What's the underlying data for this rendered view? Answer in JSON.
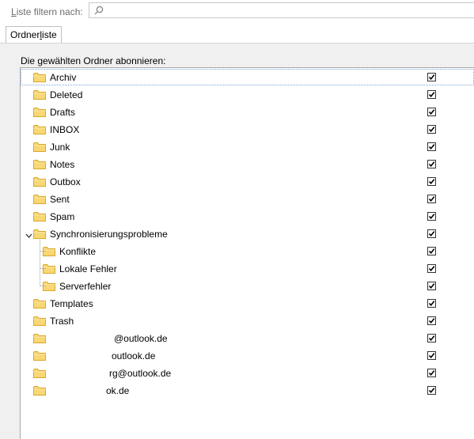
{
  "filter": {
    "label_prefix": "L",
    "label_rest": "iste filtern nach:",
    "search_icon": "search-icon",
    "value": ""
  },
  "tabs": [
    {
      "label_prefix": "Ordner",
      "label_underlined": "l",
      "label_rest": "iste"
    }
  ],
  "section_label": "Die gewählten Ordner abonnieren:",
  "folders": [
    {
      "label": "Archiv",
      "checked": true,
      "level": 0
    },
    {
      "label": "Deleted",
      "checked": true,
      "level": 0
    },
    {
      "label": "Drafts",
      "checked": true,
      "level": 0
    },
    {
      "label": "INBOX",
      "checked": true,
      "level": 0
    },
    {
      "label": "Junk",
      "checked": true,
      "level": 0
    },
    {
      "label": "Notes",
      "checked": true,
      "level": 0
    },
    {
      "label": "Outbox",
      "checked": true,
      "level": 0
    },
    {
      "label": "Sent",
      "checked": true,
      "level": 0
    },
    {
      "label": "Spam",
      "checked": true,
      "level": 0
    },
    {
      "label": "Synchronisierungsprobleme",
      "checked": true,
      "level": 0,
      "expanded": true
    },
    {
      "label": "Konflikte",
      "checked": true,
      "level": 1
    },
    {
      "label": "Lokale Fehler",
      "checked": true,
      "level": 1
    },
    {
      "label": "Serverfehler",
      "checked": true,
      "level": 1
    },
    {
      "label": "Templates",
      "checked": true,
      "level": 0
    },
    {
      "label": "Trash",
      "checked": true,
      "level": 0
    },
    {
      "label": "@outlook.de",
      "checked": true,
      "level": 0
    },
    {
      "label": "outlook.de",
      "checked": true,
      "level": 0
    },
    {
      "label": "rg@outlook.de",
      "checked": true,
      "level": 0
    },
    {
      "label": "ok.de",
      "checked": true,
      "level": 0
    }
  ],
  "colors": {
    "folder_fill": "#f8d775",
    "folder_stroke": "#d9a826",
    "selection_border": "#7aa6d6"
  }
}
